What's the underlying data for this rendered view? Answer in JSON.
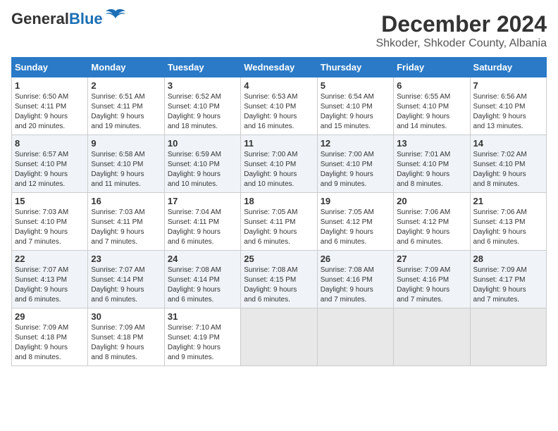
{
  "header": {
    "logo_general": "General",
    "logo_blue": "Blue",
    "title": "December 2024",
    "subtitle": "Shkoder, Shkoder County, Albania"
  },
  "calendar": {
    "weekdays": [
      "Sunday",
      "Monday",
      "Tuesday",
      "Wednesday",
      "Thursday",
      "Friday",
      "Saturday"
    ],
    "weeks": [
      [
        {
          "day": "1",
          "info": "Sunrise: 6:50 AM\nSunset: 4:11 PM\nDaylight: 9 hours\nand 20 minutes."
        },
        {
          "day": "2",
          "info": "Sunrise: 6:51 AM\nSunset: 4:11 PM\nDaylight: 9 hours\nand 19 minutes."
        },
        {
          "day": "3",
          "info": "Sunrise: 6:52 AM\nSunset: 4:10 PM\nDaylight: 9 hours\nand 18 minutes."
        },
        {
          "day": "4",
          "info": "Sunrise: 6:53 AM\nSunset: 4:10 PM\nDaylight: 9 hours\nand 16 minutes."
        },
        {
          "day": "5",
          "info": "Sunrise: 6:54 AM\nSunset: 4:10 PM\nDaylight: 9 hours\nand 15 minutes."
        },
        {
          "day": "6",
          "info": "Sunrise: 6:55 AM\nSunset: 4:10 PM\nDaylight: 9 hours\nand 14 minutes."
        },
        {
          "day": "7",
          "info": "Sunrise: 6:56 AM\nSunset: 4:10 PM\nDaylight: 9 hours\nand 13 minutes."
        }
      ],
      [
        {
          "day": "8",
          "info": "Sunrise: 6:57 AM\nSunset: 4:10 PM\nDaylight: 9 hours\nand 12 minutes."
        },
        {
          "day": "9",
          "info": "Sunrise: 6:58 AM\nSunset: 4:10 PM\nDaylight: 9 hours\nand 11 minutes."
        },
        {
          "day": "10",
          "info": "Sunrise: 6:59 AM\nSunset: 4:10 PM\nDaylight: 9 hours\nand 10 minutes."
        },
        {
          "day": "11",
          "info": "Sunrise: 7:00 AM\nSunset: 4:10 PM\nDaylight: 9 hours\nand 10 minutes."
        },
        {
          "day": "12",
          "info": "Sunrise: 7:00 AM\nSunset: 4:10 PM\nDaylight: 9 hours\nand 9 minutes."
        },
        {
          "day": "13",
          "info": "Sunrise: 7:01 AM\nSunset: 4:10 PM\nDaylight: 9 hours\nand 8 minutes."
        },
        {
          "day": "14",
          "info": "Sunrise: 7:02 AM\nSunset: 4:10 PM\nDaylight: 9 hours\nand 8 minutes."
        }
      ],
      [
        {
          "day": "15",
          "info": "Sunrise: 7:03 AM\nSunset: 4:10 PM\nDaylight: 9 hours\nand 7 minutes."
        },
        {
          "day": "16",
          "info": "Sunrise: 7:03 AM\nSunset: 4:11 PM\nDaylight: 9 hours\nand 7 minutes."
        },
        {
          "day": "17",
          "info": "Sunrise: 7:04 AM\nSunset: 4:11 PM\nDaylight: 9 hours\nand 6 minutes."
        },
        {
          "day": "18",
          "info": "Sunrise: 7:05 AM\nSunset: 4:11 PM\nDaylight: 9 hours\nand 6 minutes."
        },
        {
          "day": "19",
          "info": "Sunrise: 7:05 AM\nSunset: 4:12 PM\nDaylight: 9 hours\nand 6 minutes."
        },
        {
          "day": "20",
          "info": "Sunrise: 7:06 AM\nSunset: 4:12 PM\nDaylight: 9 hours\nand 6 minutes."
        },
        {
          "day": "21",
          "info": "Sunrise: 7:06 AM\nSunset: 4:13 PM\nDaylight: 9 hours\nand 6 minutes."
        }
      ],
      [
        {
          "day": "22",
          "info": "Sunrise: 7:07 AM\nSunset: 4:13 PM\nDaylight: 9 hours\nand 6 minutes."
        },
        {
          "day": "23",
          "info": "Sunrise: 7:07 AM\nSunset: 4:14 PM\nDaylight: 9 hours\nand 6 minutes."
        },
        {
          "day": "24",
          "info": "Sunrise: 7:08 AM\nSunset: 4:14 PM\nDaylight: 9 hours\nand 6 minutes."
        },
        {
          "day": "25",
          "info": "Sunrise: 7:08 AM\nSunset: 4:15 PM\nDaylight: 9 hours\nand 6 minutes."
        },
        {
          "day": "26",
          "info": "Sunrise: 7:08 AM\nSunset: 4:16 PM\nDaylight: 9 hours\nand 7 minutes."
        },
        {
          "day": "27",
          "info": "Sunrise: 7:09 AM\nSunset: 4:16 PM\nDaylight: 9 hours\nand 7 minutes."
        },
        {
          "day": "28",
          "info": "Sunrise: 7:09 AM\nSunset: 4:17 PM\nDaylight: 9 hours\nand 7 minutes."
        }
      ],
      [
        {
          "day": "29",
          "info": "Sunrise: 7:09 AM\nSunset: 4:18 PM\nDaylight: 9 hours\nand 8 minutes."
        },
        {
          "day": "30",
          "info": "Sunrise: 7:09 AM\nSunset: 4:18 PM\nDaylight: 9 hours\nand 8 minutes."
        },
        {
          "day": "31",
          "info": "Sunrise: 7:10 AM\nSunset: 4:19 PM\nDaylight: 9 hours\nand 9 minutes."
        },
        {
          "day": "",
          "info": ""
        },
        {
          "day": "",
          "info": ""
        },
        {
          "day": "",
          "info": ""
        },
        {
          "day": "",
          "info": ""
        }
      ]
    ]
  }
}
